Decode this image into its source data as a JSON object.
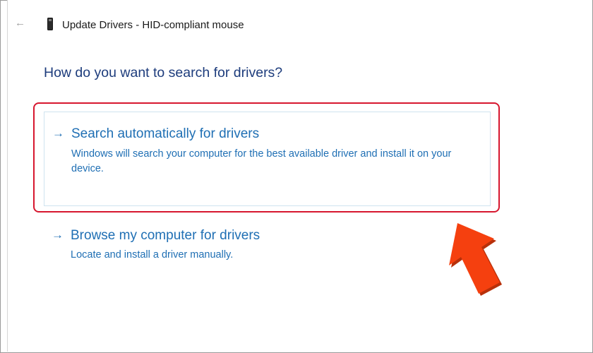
{
  "window": {
    "title": "Update Drivers - HID-compliant mouse",
    "back_icon": "back-arrow-icon",
    "device_icon": "device-icon"
  },
  "main": {
    "heading": "How do you want to search for drivers?",
    "options": [
      {
        "title": "Search automatically for drivers",
        "description": "Windows will search your computer for the best available driver and install it on your device.",
        "highlighted": true
      },
      {
        "title": "Browse my computer for drivers",
        "description": "Locate and install a driver manually.",
        "highlighted": false
      }
    ]
  },
  "colors": {
    "accent": "#1f6fb4",
    "heading": "#1d3c7c",
    "highlight": "#d7172f",
    "pointer_arrow": "#f5400f"
  }
}
